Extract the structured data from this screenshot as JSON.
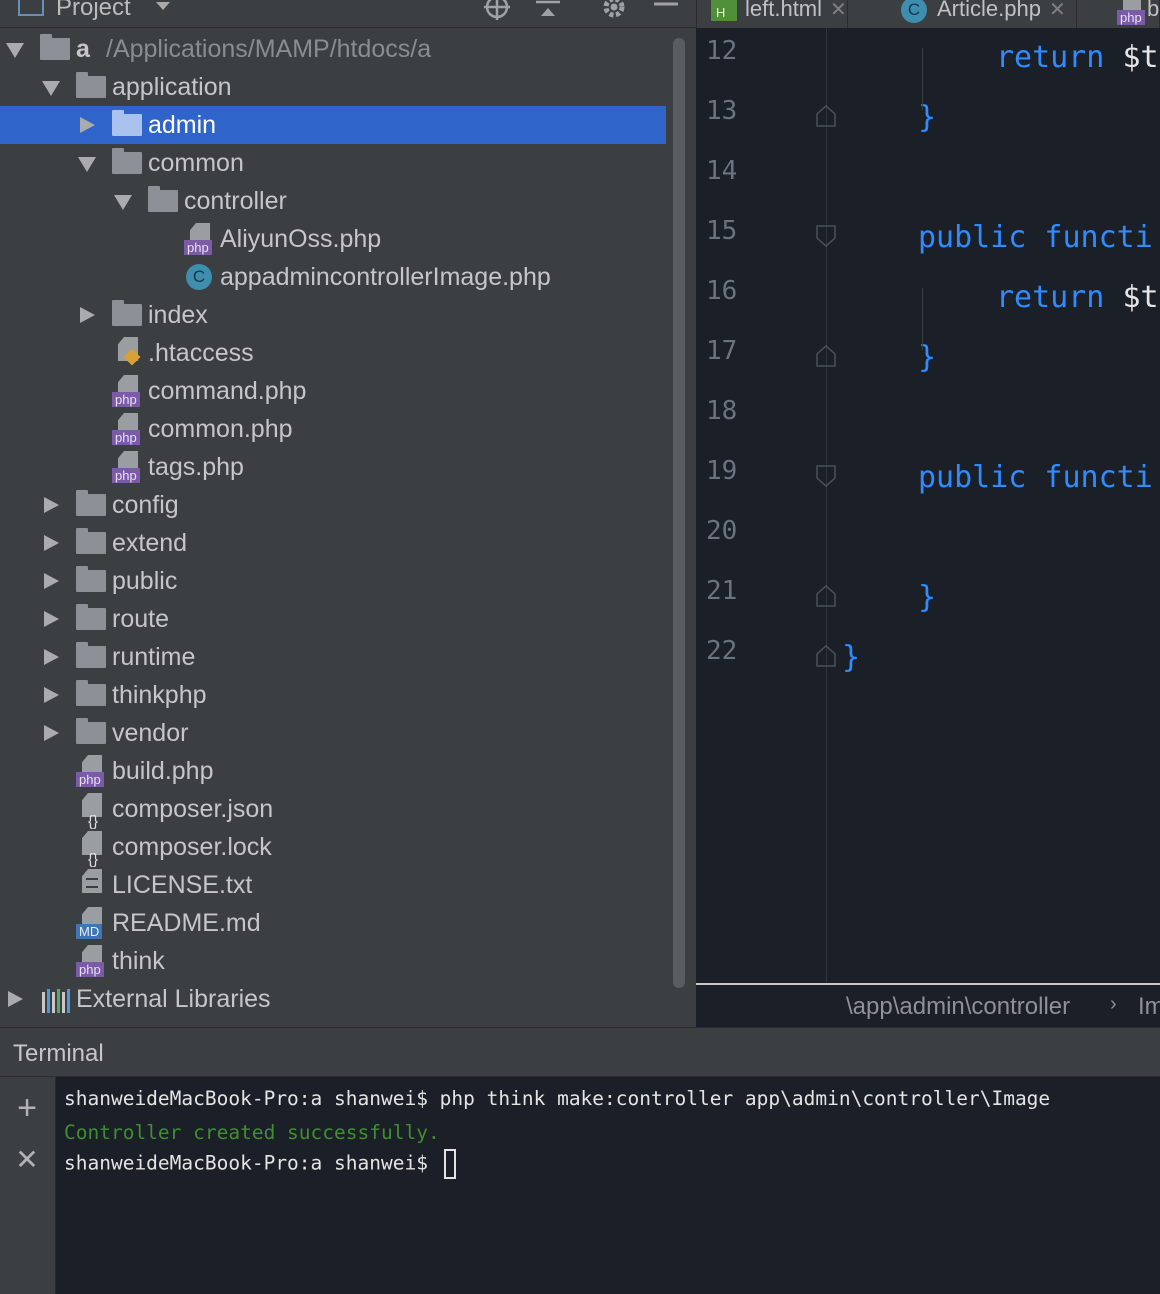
{
  "project_panel": {
    "title": "Project",
    "tree": [
      {
        "label": "a",
        "path": "/Applications/MAMP/htdocs/a",
        "level": 0,
        "type": "folder",
        "expanded": true
      },
      {
        "label": "application",
        "level": 1,
        "type": "folder",
        "expanded": true
      },
      {
        "label": "admin",
        "level": 2,
        "type": "folder",
        "expanded": false,
        "selected": true
      },
      {
        "label": "common",
        "level": 2,
        "type": "folder",
        "expanded": true
      },
      {
        "label": "controller",
        "level": 3,
        "type": "folder",
        "expanded": true
      },
      {
        "label": "AliyunOss.php",
        "level": 4,
        "type": "php"
      },
      {
        "label": "appadmincontrollerImage.php",
        "level": 4,
        "type": "class"
      },
      {
        "label": "index",
        "level": 2,
        "type": "folder",
        "expanded": false
      },
      {
        "label": ".htaccess",
        "level": 2,
        "type": "htaccess"
      },
      {
        "label": "command.php",
        "level": 2,
        "type": "php"
      },
      {
        "label": "common.php",
        "level": 2,
        "type": "php"
      },
      {
        "label": "tags.php",
        "level": 2,
        "type": "php"
      },
      {
        "label": "config",
        "level": 1,
        "type": "folder",
        "expanded": false
      },
      {
        "label": "extend",
        "level": 1,
        "type": "folder",
        "expanded": false
      },
      {
        "label": "public",
        "level": 1,
        "type": "folder",
        "expanded": false
      },
      {
        "label": "route",
        "level": 1,
        "type": "folder",
        "expanded": false
      },
      {
        "label": "runtime",
        "level": 1,
        "type": "folder",
        "expanded": false
      },
      {
        "label": "thinkphp",
        "level": 1,
        "type": "folder",
        "expanded": false
      },
      {
        "label": "vendor",
        "level": 1,
        "type": "folder",
        "expanded": false
      },
      {
        "label": "build.php",
        "level": 1,
        "type": "php"
      },
      {
        "label": "composer.json",
        "level": 1,
        "type": "json"
      },
      {
        "label": "composer.lock",
        "level": 1,
        "type": "json"
      },
      {
        "label": "LICENSE.txt",
        "level": 1,
        "type": "txt"
      },
      {
        "label": "README.md",
        "level": 1,
        "type": "md"
      },
      {
        "label": "think",
        "level": 1,
        "type": "php"
      },
      {
        "label": "External Libraries",
        "level": 0,
        "type": "library",
        "expanded": false
      }
    ]
  },
  "tabs": [
    {
      "label": "left.html",
      "icon": "html-file-icon",
      "icon_text": "H"
    },
    {
      "label": "Article.php",
      "icon": "class-file-icon",
      "icon_text": "C"
    },
    {
      "label": "b",
      "icon": "php-file-icon",
      "icon_text": "php"
    }
  ],
  "editor": {
    "lines": [
      {
        "num": "12",
        "code": [
          {
            "t": "return $t",
            "c": "kw-ret"
          }
        ]
      },
      {
        "num": "13",
        "code": [
          {
            "t": "}",
            "c": "brace"
          }
        ]
      },
      {
        "num": "14",
        "code": []
      },
      {
        "num": "15",
        "code": [
          {
            "t": "public functi",
            "c": "kw"
          }
        ]
      },
      {
        "num": "16",
        "code": [
          {
            "t": "return $t",
            "c": "kw-ret"
          }
        ]
      },
      {
        "num": "17",
        "code": [
          {
            "t": "}",
            "c": "brace"
          }
        ]
      },
      {
        "num": "18",
        "code": []
      },
      {
        "num": "19",
        "code": [
          {
            "t": "public functi",
            "c": "kw"
          }
        ]
      },
      {
        "num": "20",
        "code": []
      },
      {
        "num": "21",
        "code": [
          {
            "t": "}",
            "c": "brace"
          }
        ]
      },
      {
        "num": "22",
        "code": [
          {
            "t": "}",
            "c": "brace"
          }
        ]
      }
    ],
    "breadcrumb": "\\app\\admin\\controller",
    "breadcrumb_tail": "Im",
    "breadcrumb_sep": "›"
  },
  "terminal": {
    "title": "Terminal",
    "new_session_glyph": "+",
    "close_session_glyph": "✕",
    "lines": [
      {
        "text": "shanweideMacBook-Pro:a shanwei$ php think make:controller app\\admin\\controller\\Image",
        "style": "normal"
      },
      {
        "text": "Controller created successfully.",
        "style": "success"
      },
      {
        "text": "shanweideMacBook-Pro:a shanwei$ ",
        "style": "prompt"
      }
    ]
  },
  "colors": {
    "selection": "#2f65ca",
    "keyword": "#2f8cff",
    "success": "#3f8f2f",
    "panel_bg": "#3c3f41",
    "editor_bg": "#1b1f27"
  }
}
